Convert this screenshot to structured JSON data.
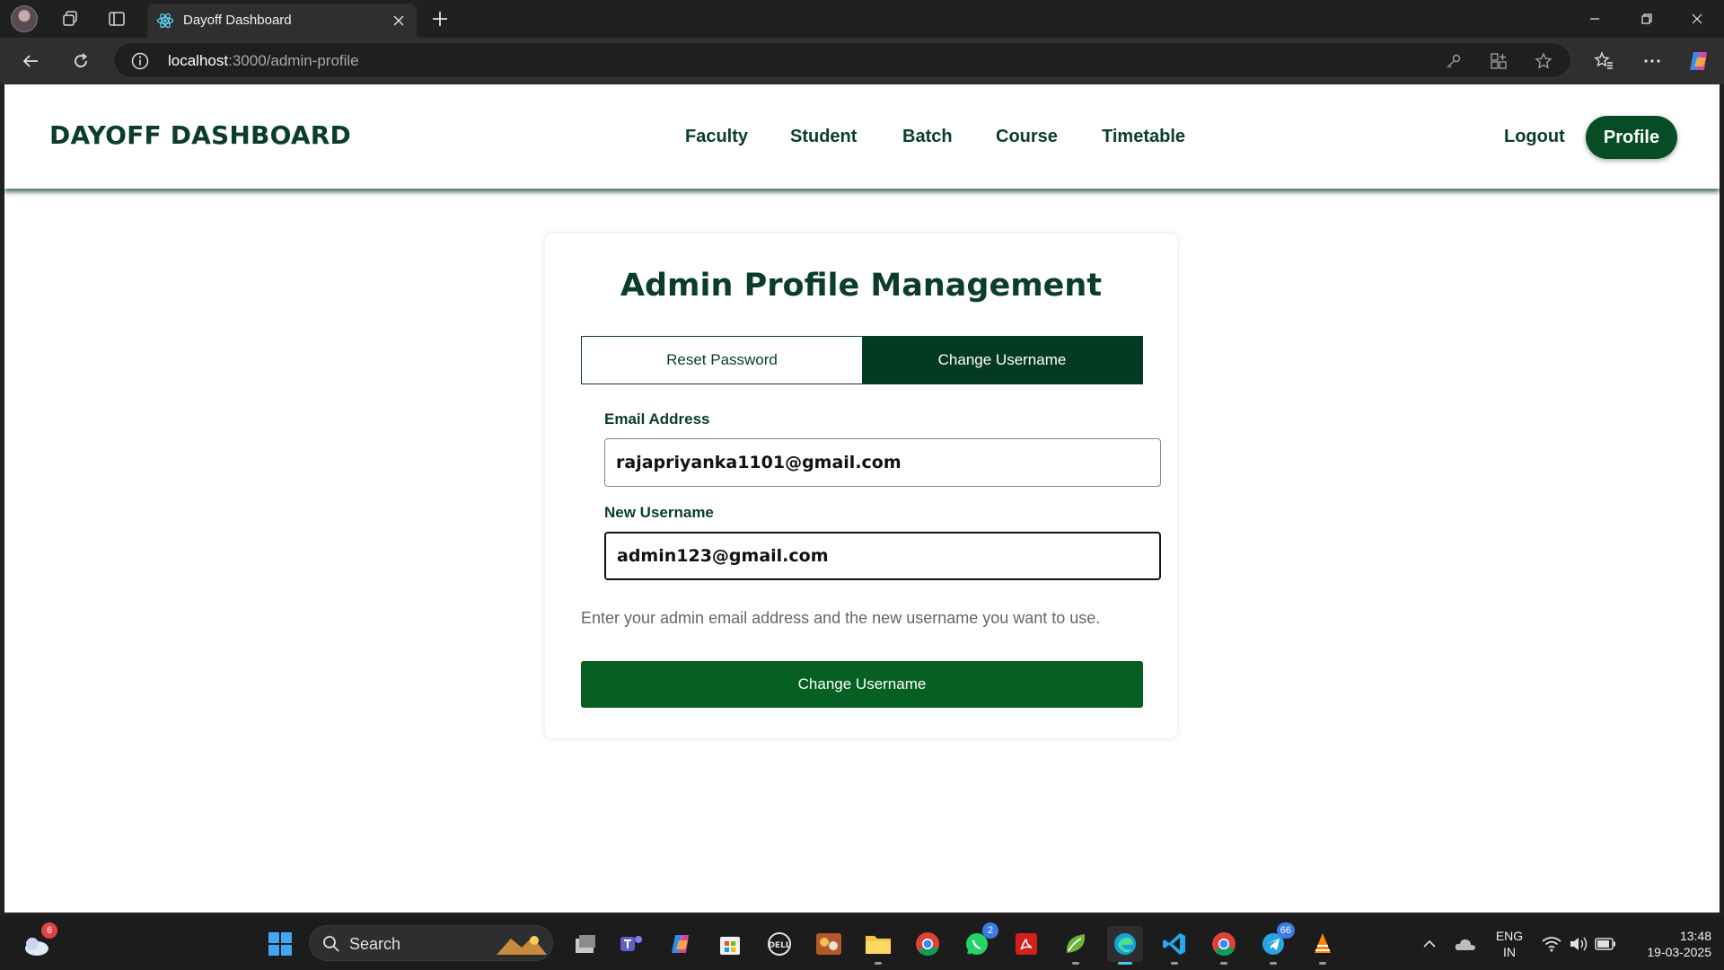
{
  "browser": {
    "tab_title": "Dayoff Dashboard",
    "address_host": "localhost",
    "address_path": ":3000/admin-profile"
  },
  "navbar": {
    "brand": "DAYOFF DASHBOARD",
    "links": [
      {
        "label": "Faculty"
      },
      {
        "label": "Student"
      },
      {
        "label": "Batch"
      },
      {
        "label": "Course"
      },
      {
        "label": "Timetable"
      }
    ],
    "logout_label": "Logout",
    "profile_label": "Profile"
  },
  "card": {
    "title": "Admin Profile Management",
    "tabs": [
      {
        "label": "Reset Password",
        "active": false
      },
      {
        "label": "Change Username",
        "active": true
      }
    ],
    "email_label": "Email Address",
    "email_value": "rajapriyanka1101@gmail.com",
    "username_label": "New Username",
    "username_value": "admin123@gmail.com",
    "hint": "Enter your admin email address and the new username you want to use.",
    "submit_label": "Change Username"
  },
  "taskbar": {
    "search_label": "Search",
    "weather_badge": "6",
    "whatsapp_badge": "2",
    "telegram_badge": "66",
    "lang_line1": "ENG",
    "lang_line2": "IN",
    "time": "13:48",
    "date": "19-03-2025"
  },
  "colors": {
    "brand_dark": "#0a3d2a",
    "active_tab": "#043a24",
    "submit_green": "#065f23",
    "profile_green": "#064d26"
  }
}
